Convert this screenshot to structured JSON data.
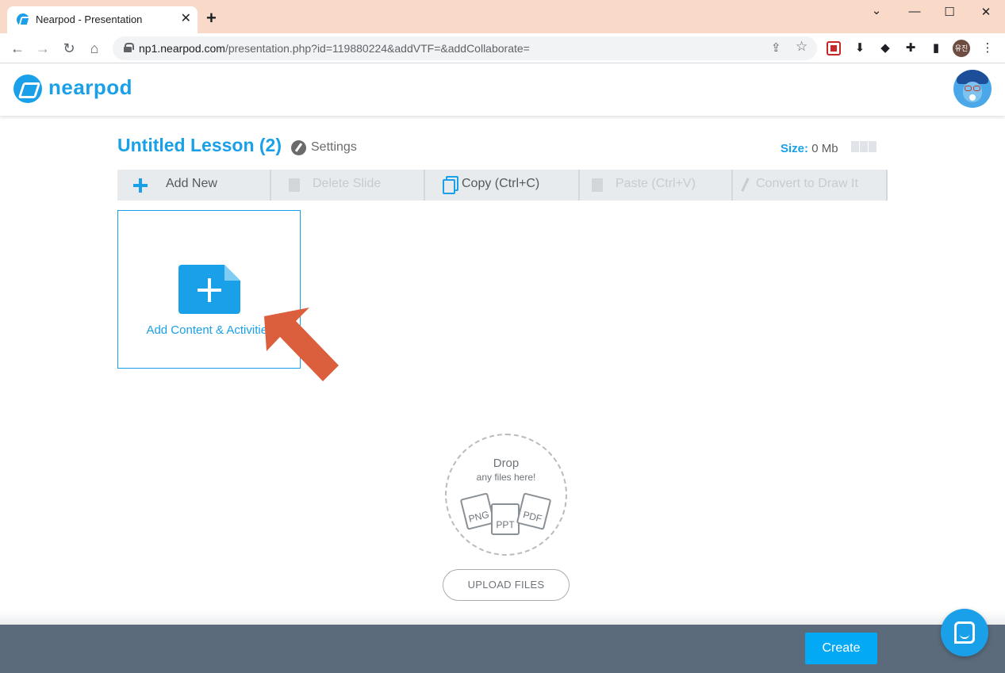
{
  "browser": {
    "tab_title": "Nearpod - Presentation",
    "tab_close": "✕",
    "new_tab": "+",
    "window_controls": {
      "minimize": "—",
      "maximize": "☐",
      "close": "✕",
      "tab_search": "⌄"
    },
    "url_host": "np1.nearpod.com",
    "url_path": "/presentation.php?id=119880224&addVTF=&addCollaborate=",
    "profile_initials": "유진",
    "icons": {
      "back": "←",
      "forward": "→",
      "reload": "↻",
      "home": "⌂",
      "share": "⇪",
      "star": "☆",
      "puzzle": "✚",
      "sidepanel": "▮",
      "menu": "⋮",
      "download": "⬇",
      "ext_gray": "◆"
    }
  },
  "app": {
    "logo_text": "nearpod",
    "brand_color": "#1aa0e8"
  },
  "lesson": {
    "title": "Untitled Lesson (2)",
    "settings_label": "Settings",
    "size_label": "Size:",
    "size_value": "0 Mb"
  },
  "toolbar": {
    "add_new": "Add New",
    "delete_slide": "Delete Slide",
    "copy": "Copy (Ctrl+C)",
    "paste": "Paste (Ctrl+V)",
    "convert": "Convert to Draw It"
  },
  "add_card": {
    "label": "Add Content & Activities"
  },
  "dropzone": {
    "title": "Drop",
    "subtitle": "any files here!",
    "file_types": [
      "PNG",
      "PPT",
      "PDF"
    ],
    "upload_label": "UPLOAD FILES"
  },
  "footer": {
    "create_label": "Create"
  }
}
